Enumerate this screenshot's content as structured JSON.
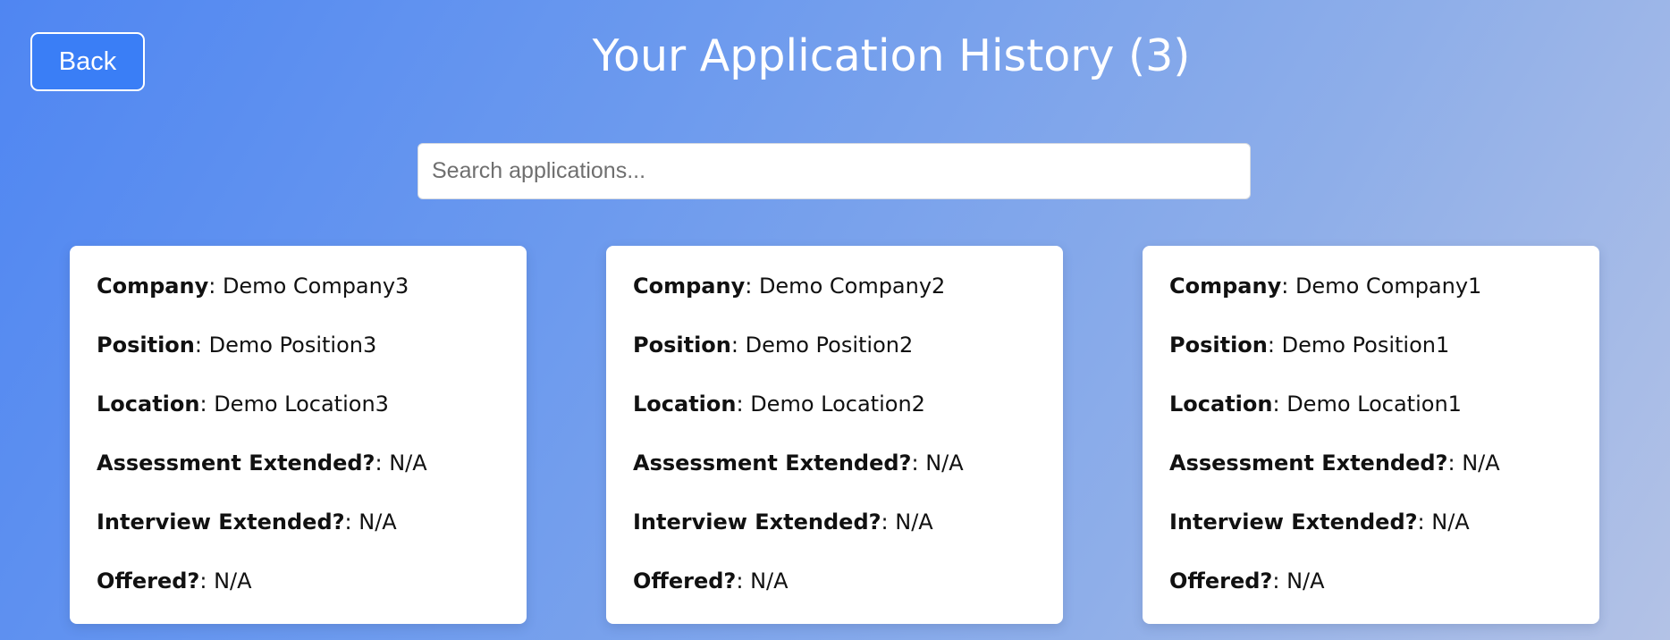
{
  "header": {
    "back_label": "Back",
    "title": "Your Application History (3)"
  },
  "search": {
    "placeholder": "Search applications...",
    "value": ""
  },
  "cards": [
    {
      "company_label": "Company",
      "company": "Demo Company3",
      "position_label": "Position",
      "position": "Demo Position3",
      "location_label": "Location",
      "location": "Demo Location3",
      "assessment_label": "Assessment Extended?",
      "assessment": "N/A",
      "interview_label": "Interview Extended?",
      "interview": "N/A",
      "offered_label": "Offered?",
      "offered": "N/A"
    },
    {
      "company_label": "Company",
      "company": "Demo Company2",
      "position_label": "Position",
      "position": "Demo Position2",
      "location_label": "Location",
      "location": "Demo Location2",
      "assessment_label": "Assessment Extended?",
      "assessment": "N/A",
      "interview_label": "Interview Extended?",
      "interview": "N/A",
      "offered_label": "Offered?",
      "offered": "N/A"
    },
    {
      "company_label": "Company",
      "company": "Demo Company1",
      "position_label": "Position",
      "position": "Demo Position1",
      "location_label": "Location",
      "location": "Demo Location1",
      "assessment_label": "Assessment Extended?",
      "assessment": "N/A",
      "interview_label": "Interview Extended?",
      "interview": "N/A",
      "offered_label": "Offered?",
      "offered": "N/A"
    }
  ],
  "colors": {
    "back_button": "#3a7ef6",
    "gradient_start": "#4f86f2",
    "gradient_end": "#b3c2e6"
  }
}
